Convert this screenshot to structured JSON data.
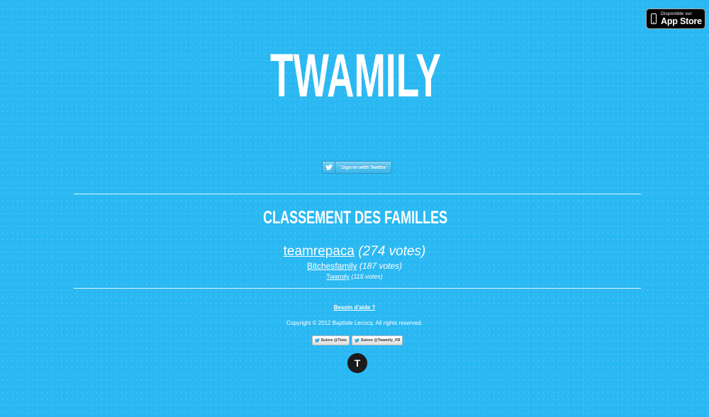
{
  "appstore": {
    "line1": "Disponible sur",
    "line2": "App Store",
    "icon": "iphone-icon"
  },
  "header": {
    "title": "TWAMILY"
  },
  "signin": {
    "label": "Sign-in with Twitter",
    "icon": "twitter-bird-icon"
  },
  "ranking": {
    "title": "CLASSEMENT DES FAMILLES",
    "families": [
      {
        "name": "teamrepaca",
        "votes": "(274 votes)"
      },
      {
        "name": "Bitchesfamily",
        "votes": "(187 votes)"
      },
      {
        "name": "Twamily",
        "votes": "(115 votes)"
      }
    ]
  },
  "footer": {
    "help": "Besoin d'aide ?",
    "copyright": "Copyright © 2012 Baptiste Lecocq. All rights reserved.",
    "follow_buttons": [
      {
        "label": "Suivre @Tiste"
      },
      {
        "label": "Suivre @Twamily_FR"
      }
    ],
    "logo_letter": "T"
  },
  "colors": {
    "background": "#2ab9f3",
    "text": "#ffffff",
    "badge": "#000000"
  }
}
